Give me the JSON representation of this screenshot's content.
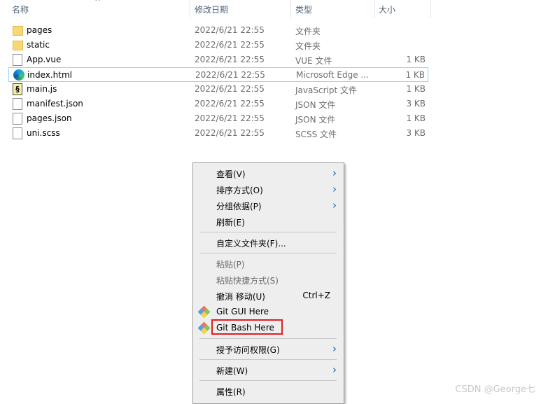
{
  "columns": {
    "name": "名称",
    "modified": "修改日期",
    "type": "类型",
    "size": "大小"
  },
  "files": [
    {
      "name": "pages",
      "modified": "2022/6/21 22:55",
      "type": "文件夹",
      "size": "",
      "icon": "folder-icon"
    },
    {
      "name": "static",
      "modified": "2022/6/21 22:55",
      "type": "文件夹",
      "size": "",
      "icon": "folder-icon"
    },
    {
      "name": "App.vue",
      "modified": "2022/6/21 22:55",
      "type": "VUE 文件",
      "size": "1 KB",
      "icon": "file-icon"
    },
    {
      "name": "index.html",
      "modified": "2022/6/21 22:55",
      "type": "Microsoft Edge ...",
      "size": "1 KB",
      "icon": "edge-icon",
      "selected": true
    },
    {
      "name": "main.js",
      "modified": "2022/6/21 22:55",
      "type": "JavaScript 文件",
      "size": "1 KB",
      "icon": "js-file-icon"
    },
    {
      "name": "manifest.json",
      "modified": "2022/6/21 22:55",
      "type": "JSON 文件",
      "size": "3 KB",
      "icon": "file-icon"
    },
    {
      "name": "pages.json",
      "modified": "2022/6/21 22:55",
      "type": "JSON 文件",
      "size": "1 KB",
      "icon": "file-icon"
    },
    {
      "name": "uni.scss",
      "modified": "2022/6/21 22:55",
      "type": "SCSS 文件",
      "size": "3 KB",
      "icon": "file-icon"
    }
  ],
  "menu": [
    {
      "label": "查看(V)",
      "submenu": true
    },
    {
      "label": "排序方式(O)",
      "submenu": true
    },
    {
      "label": "分组依据(P)",
      "submenu": true
    },
    {
      "label": "刷新(E)"
    },
    {
      "sep": true
    },
    {
      "label": "自定义文件夹(F)..."
    },
    {
      "sep": true
    },
    {
      "label": "粘贴(P)",
      "disabled": true
    },
    {
      "label": "粘贴快捷方式(S)",
      "disabled": true
    },
    {
      "label": "撤消 移动(U)",
      "shortcut": "Ctrl+Z"
    },
    {
      "label": "Git GUI Here",
      "icon": "git-icon"
    },
    {
      "label": "Git Bash Here",
      "icon": "git-icon",
      "highlighted": true
    },
    {
      "sep": true
    },
    {
      "label": "授予访问权限(G)",
      "submenu": true
    },
    {
      "sep": true
    },
    {
      "label": "新建(W)",
      "submenu": true
    },
    {
      "sep": true
    },
    {
      "label": "属性(R)"
    }
  ],
  "highlight_color": "#e02020",
  "watermark": "CSDN @George七"
}
